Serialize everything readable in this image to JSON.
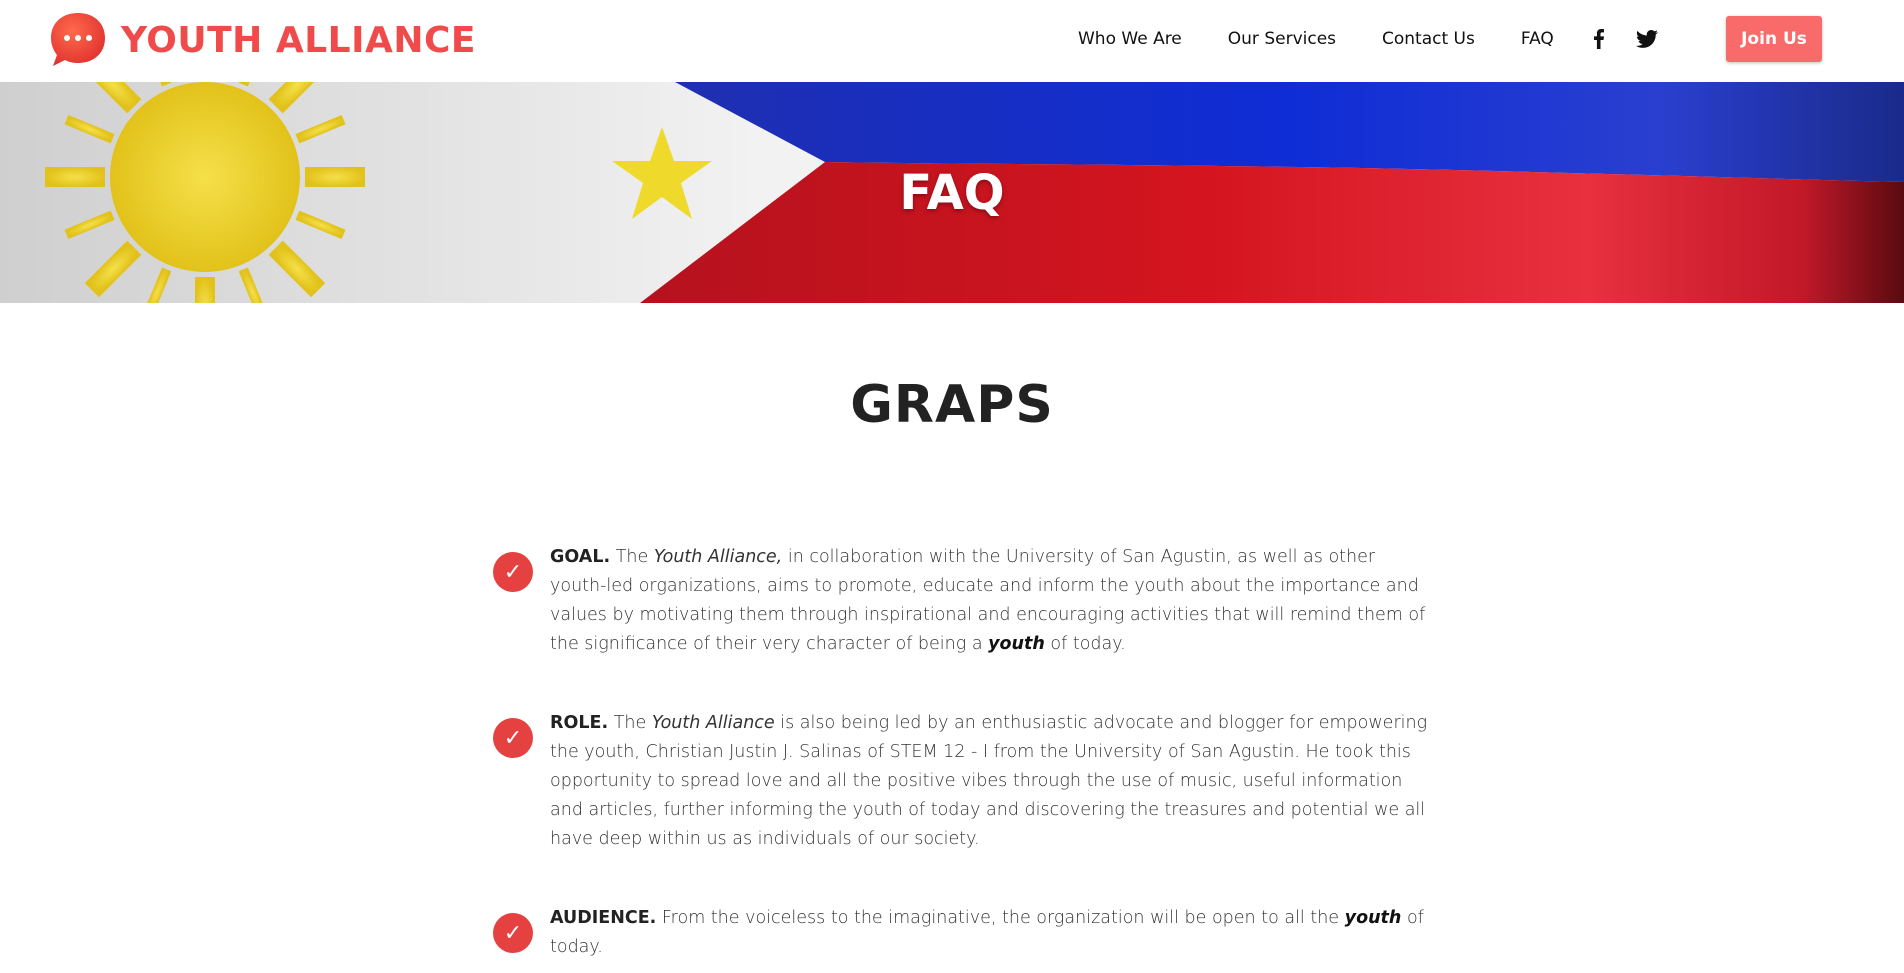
{
  "brand": {
    "name": "YOUTH ALLIANCE",
    "logo_icon": "chat-bubble-icon",
    "accent": "#f04a4a"
  },
  "nav": {
    "items": [
      "Who We Are",
      "Our Services",
      "Contact Us",
      "FAQ"
    ],
    "social": [
      "facebook-icon",
      "twitter-icon"
    ],
    "join_label": "Join Us"
  },
  "banner": {
    "title": "FAQ"
  },
  "section": {
    "title": "GRAPS"
  },
  "faq": [
    {
      "label": "GOAL.",
      "pre": "The",
      "em": "Youth Alliance,",
      "mid": "in collaboration with the University of San Agustin, as well as other youth-led organizations, aims to promote, educate and inform the youth about the importance and values by motivating them through inspirational and encouraging activities that will remind them of the significance of their very character of being a",
      "strong": "youth",
      "post": "of today."
    },
    {
      "label": "ROLE.",
      "pre": "The",
      "em": "Youth Alliance",
      "mid": "is also being led by an enthusiastic advocate and blogger for empowering the youth, Christian Justin J. Salinas of STEM 12 - I from the University of San Agustin. He took this opportunity to spread love and all the positive vibes through the use of music, useful information and articles, further informing the youth of today and discovering the treasures and potential we all have deep within us as individuals of our society."
    },
    {
      "label": "AUDIENCE.",
      "mid": "From the voiceless to the imaginative, the organization will be open to all the",
      "strong": "youth",
      "post": "of today."
    }
  ]
}
